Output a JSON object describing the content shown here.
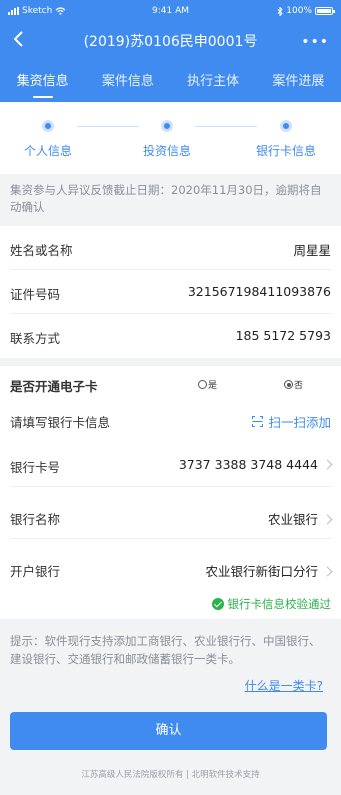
{
  "status_bar": {
    "carrier": "Sketch",
    "time": "9:41 AM",
    "battery": "100%"
  },
  "nav": {
    "title": "(2019)苏0106民申0001号",
    "more": "•••"
  },
  "tabs": [
    "集资信息",
    "案件信息",
    "执行主体",
    "案件进展"
  ],
  "steps": [
    "个人信息",
    "投资信息",
    "银行卡信息"
  ],
  "notice": "集资参与人异议反馈截止日期：2020年11月30日，逾期将自动确认",
  "personal": {
    "name_label": "姓名或名称",
    "name_value": "周星星",
    "id_label": "证件号码",
    "id_value": "321567198411093876",
    "contact_label": "联系方式",
    "contact_value": "185 5172 5793"
  },
  "ecard": {
    "label": "是否开通电子卡",
    "yes": "是",
    "no": "否",
    "selected": "否"
  },
  "bank": {
    "fill_label": "请填写银行卡信息",
    "scan_label": "扫一扫添加",
    "card_no_label": "银行卡号",
    "card_no_value": "3737 3388 3748 4444",
    "bank_name_label": "银行名称",
    "bank_name_value": "农业银行",
    "branch_label": "开户银行",
    "branch_value": "农业银行新街口分行",
    "verify_text": "银行卡信息校验通过"
  },
  "tip": {
    "text": "提示：软件现行支持添加工商银行、农业银行行、中国银行、建设银行、交通银行和邮政储蓄银行一类卡。",
    "link": "什么是一类卡?"
  },
  "confirm_label": "确认",
  "footer": "江苏高级人民法院版权所有 | 北明软件技术支持",
  "colors": {
    "primary": "#3f8bf0",
    "success": "#2bb24c"
  }
}
